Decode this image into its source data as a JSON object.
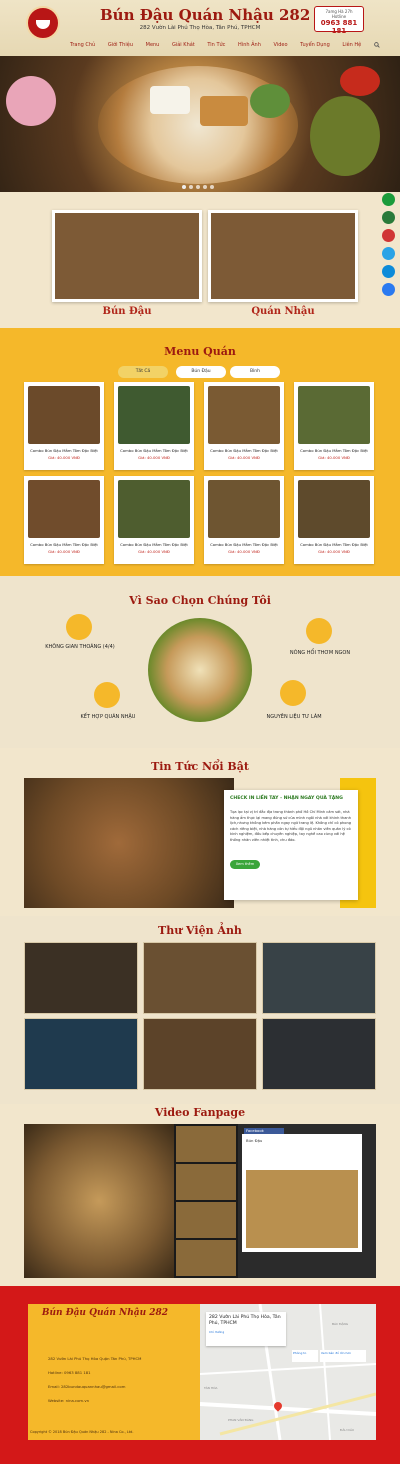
{
  "header": {
    "brand": "Bún Đậu  Quán Nhậu 282",
    "address": "282 Vườn Lài Phú Thọ Hòa, Tân Phú, TPHCM",
    "hotline_hours": "7amg Hà 27h",
    "hotline_label": "Hotline",
    "hotline_number": "0963 881 181",
    "nav": [
      "Trang Chủ",
      "Giới Thiệu",
      "Menu",
      "Giải Khát",
      "Tin Tức",
      "Hình Ảnh",
      "Video",
      "Tuyển Dụng",
      "Liên Hệ"
    ]
  },
  "categories": [
    "Bún Đậu",
    "Quán Nhậu"
  ],
  "menu": {
    "title": "Menu Quán",
    "tabs": [
      "Tất Cả",
      "Bún Đậu",
      "Bình"
    ],
    "item_name": "Combo Bún Đậu Mắm Tôm Đặc Biệt",
    "item_price": "Giá: 40.000 VNĐ"
  },
  "why": {
    "title": "Vì Sao Chọn Chúng Tôi",
    "items": [
      "KHÔNG GIAN THOÁNG (4/4)",
      "NÓNG HỔI THƠM NGON",
      "KẾT HỢP QUÁN NHẬU",
      "NGUYÊN LIỆU TƯ LÀM"
    ]
  },
  "news": {
    "title": "Tin Tức Nổi Bật",
    "headline": "CHECK IN LIỀN TAY - NHẬN NGAY QUÀ TẶNG",
    "body": "Tọa lạc tại vị trí đắc địa trong thành phố Hồ Chí Minh cảm sát, nhà hàng ẩm thực lại mang đúng sứ của mình ngôi nhà với khinh thanh lịch,nhưng không kém phần ngay ngữ trang lệ. Không chỉ có phong cách riêng biệt, nhà hàng còn tự hiểu đội ngũ nhân viên quản lý có kinh nghiệm, đầu bếp chuyên nghiệp, tay nghề cao cùng với hệ thống nhân viên nhiệt tình, chu đáo.",
    "button": "Xem thêm"
  },
  "gallery": {
    "title": "Thư Viện Ảnh"
  },
  "video": {
    "title": "Video Fanpage",
    "fb_name": "Facebook",
    "fb_page": "Bún Đậu"
  },
  "footer": {
    "title": "Bún Đậu Quán Nhậu 282",
    "lines": [
      "282 Vườn Lài Phú Thọ Hòa Quận Tân Phú, TPHCM",
      "Hotline: 0963 881 181",
      "Email: 282bundauquannhau@gmail.com",
      "Website: nina.com.vn"
    ],
    "copyright": "Copyright © 2018 Bún Đậu Quán Nhậu 282 - Nina Co., Ltd.",
    "map_address": "282 Vườn Lài Phú Thọ Hòa, Tân Phú, TPHCM",
    "map_links": [
      "Chỉ đường",
      "Phóng to",
      "Xem bản đồ lớn hơn"
    ],
    "map_streets": [
      "PHAN VĂN ĐÁNG",
      "TÂN HÒA",
      "BÁC ĐẶNG",
      "ĐẦU DẤU"
    ]
  },
  "colors": {
    "brand_red": "#9c1a10",
    "menu_yellow": "#f5b82a",
    "footer_red": "#d31818",
    "news_green": "#3aa53a"
  },
  "icons": [
    "logo-bowl-icon",
    "search-icon",
    "phone-icon",
    "zalo-icon",
    "message-icon",
    "messenger-icon",
    "map-pin-icon"
  ]
}
